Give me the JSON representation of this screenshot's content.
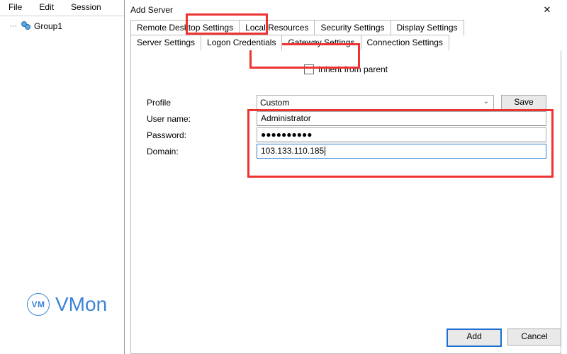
{
  "menubar": {
    "file": "File",
    "edit": "Edit",
    "session": "Session"
  },
  "tree": {
    "expand": "⋯",
    "group1": "Group1"
  },
  "dialog": {
    "title": "Add Server",
    "close": "✕",
    "tabs": {
      "row1": [
        "Remote Desktop Settings",
        "Local Resources",
        "Security Settings",
        "Display Settings"
      ],
      "row2": [
        "Server Settings",
        "Logon Credentials",
        "Gateway Settings",
        "Connection Settings"
      ],
      "active": "Logon Credentials"
    },
    "inherit": {
      "label": "Inherit from parent",
      "checked": false
    },
    "form": {
      "profile": {
        "label": "Profile",
        "value": "Custom",
        "save": "Save"
      },
      "username": {
        "label": "User name:",
        "value": "Administrator"
      },
      "password": {
        "label": "Password:",
        "value": "●●●●●●●●●●"
      },
      "domain": {
        "label": "Domain:",
        "value": "103.133.110.185"
      }
    },
    "buttons": {
      "add": "Add",
      "cancel": "Cancel"
    }
  },
  "watermark": {
    "logo": "VM",
    "text": "VMon"
  }
}
